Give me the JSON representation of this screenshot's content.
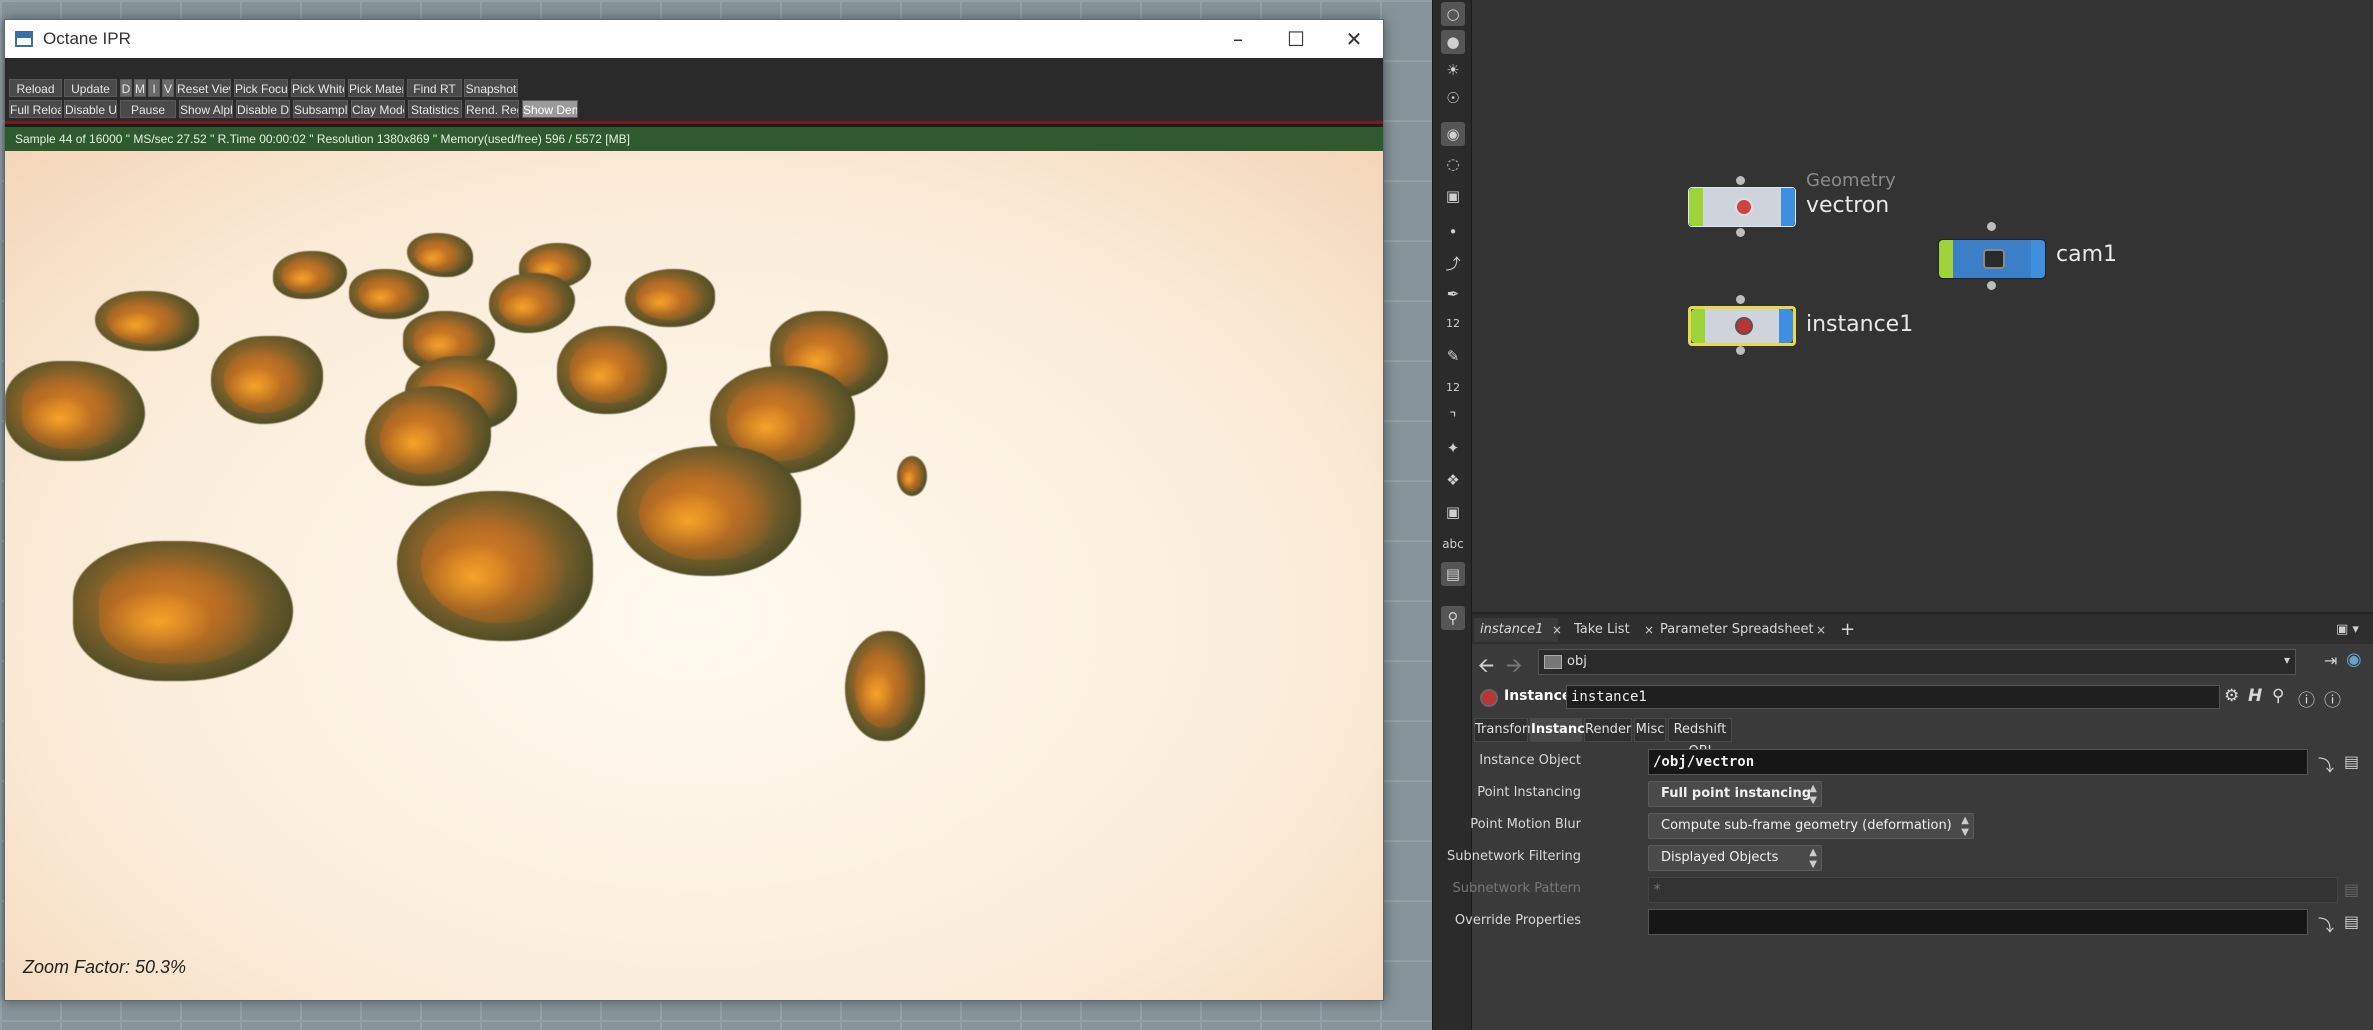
{
  "ipr": {
    "title": "Octane IPR",
    "toolbar_row1": [
      "Reload",
      "Update",
      "D",
      "M",
      "I",
      "V",
      "Reset View",
      "Pick Focus",
      "Pick WhiteP",
      "Pick Material",
      "Find RT",
      "Snapshot"
    ],
    "toolbar_row2": [
      "Full Reload",
      "Disable Upd.",
      "Pause",
      "Show Alpha",
      "Disable DOF",
      "Subsampling",
      "Clay Mode",
      "Statistics",
      "Rend. Region",
      "Show Denoise"
    ],
    "status": "Sample 44 of 16000 \" MS/sec 27.52 \" R.Time 00:00:02 \" Resolution 1380x869 \" Memory(used/free) 596 / 5572 [MB]",
    "zoom_label": "Zoom Factor: 50.3%"
  },
  "shelf": {
    "icons": [
      "sphere-icon",
      "light-icon",
      "bulb-icon",
      "sky-light-icon",
      "camera-icon",
      "eye-icon",
      "render-icon",
      "point-icon",
      "curve-icon",
      "pen-icon",
      "number-icon",
      "sculpt-icon",
      "number-icon",
      "ruler-icon",
      "transform-icon",
      "bone-icon",
      "box-icon",
      "abc-text-icon",
      "image-icon",
      "location-icon"
    ],
    "abc": "abc",
    "num": "12"
  },
  "network": {
    "nodes": [
      {
        "name": "vectron",
        "sublabel": "Geometry"
      },
      {
        "name": "cam1",
        "sublabel": ""
      },
      {
        "name": "instance1",
        "sublabel": ""
      }
    ]
  },
  "param_pane": {
    "tabs": [
      {
        "label": "instance1"
      },
      {
        "label": "Take List"
      },
      {
        "label": "Parameter Spreadsheet"
      }
    ],
    "add_tab": "+",
    "path": "obj",
    "node_type": "Instance",
    "node_name": "instance1",
    "param_tabs": [
      "Transform",
      "Instance",
      "Render",
      "Misc",
      "Redshift OBJ"
    ],
    "params": [
      {
        "label": "Instance Object",
        "value": "/obj/vectron"
      },
      {
        "label": "Point Instancing",
        "value": "Full point instancing"
      },
      {
        "label": "Point Motion Blur",
        "value": "Compute sub-frame geometry (deformation)"
      },
      {
        "label": "Subnetwork Filtering",
        "value": "Displayed Objects"
      },
      {
        "label": "Subnetwork Pattern",
        "value": "*"
      },
      {
        "label": "Override Properties",
        "value": ""
      }
    ]
  },
  "colors": {
    "node_green": "#9fd33a",
    "node_blue": "#3f8fe0",
    "node_selected": "#e8d84a",
    "ipr_status_bg": "#2f5a2f"
  }
}
